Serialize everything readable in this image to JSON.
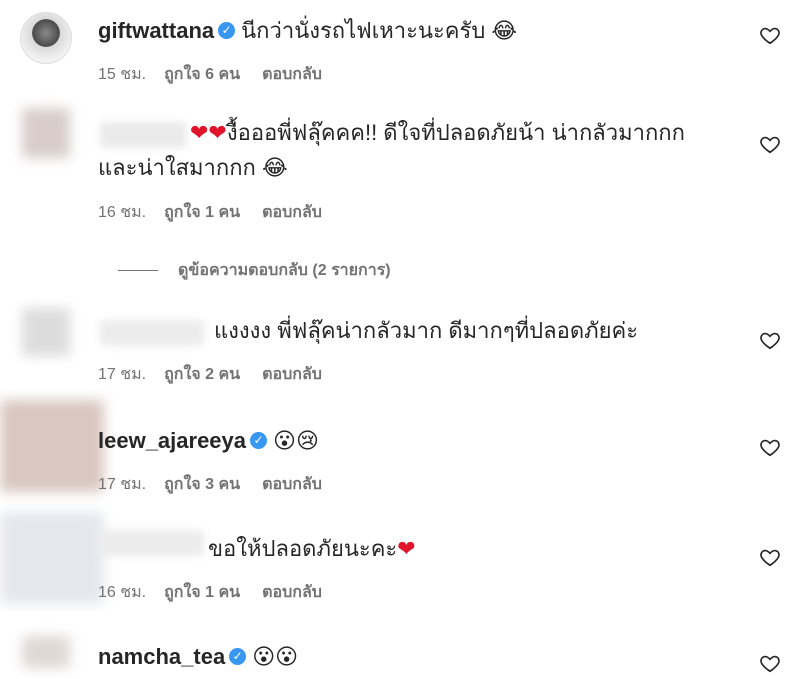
{
  "comments": [
    {
      "username": "giftwattana",
      "verified": true,
      "text": "นีกว่านั่งรถไฟเหาะนะครับ",
      "emoji": "😂",
      "time": "15 ชม.",
      "likes": "ถูกใจ 6 คน",
      "reply": "ตอบกลับ"
    },
    {
      "username": "",
      "text_prefix": "❤❤",
      "text": "งื้อออพี่ฟลุ๊คคค!! ดีใจที่ปลอดภัยน้า น่ากลัวมากกก และน่าใสมากกก",
      "emoji": "😂",
      "time": "16 ชม.",
      "likes": "ถูกใจ 1 คน",
      "reply": "ตอบกลับ",
      "view_replies": "ดูข้อความตอบกลับ (2 รายการ)"
    },
    {
      "username": "",
      "text": "แงงงง พี่ฟลุ๊คน่ากลัวมาก ดีมากๆที่ปลอดภัยค่ะ",
      "time": "17 ชม.",
      "likes": "ถูกใจ 2 คน",
      "reply": "ตอบกลับ"
    },
    {
      "username": "leew_ajareeya",
      "verified": true,
      "emoji": "😮😢",
      "time": "17 ชม.",
      "likes": "ถูกใจ 3 คน",
      "reply": "ตอบกลับ"
    },
    {
      "username": "",
      "text": "ขอให้ปลอดภัยนะคะ",
      "emoji_suffix": "❤",
      "time": "16 ชม.",
      "likes": "ถูกใจ 1 คน",
      "reply": "ตอบกลับ"
    },
    {
      "username": "namcha_tea",
      "verified": true,
      "emoji": "😮😮"
    }
  ],
  "icons": {
    "verified": "verified-badge-icon",
    "like": "heart-outline-icon"
  },
  "colors": {
    "verified": "#3897f0",
    "heart": "#e0142a",
    "meta": "#737373"
  }
}
